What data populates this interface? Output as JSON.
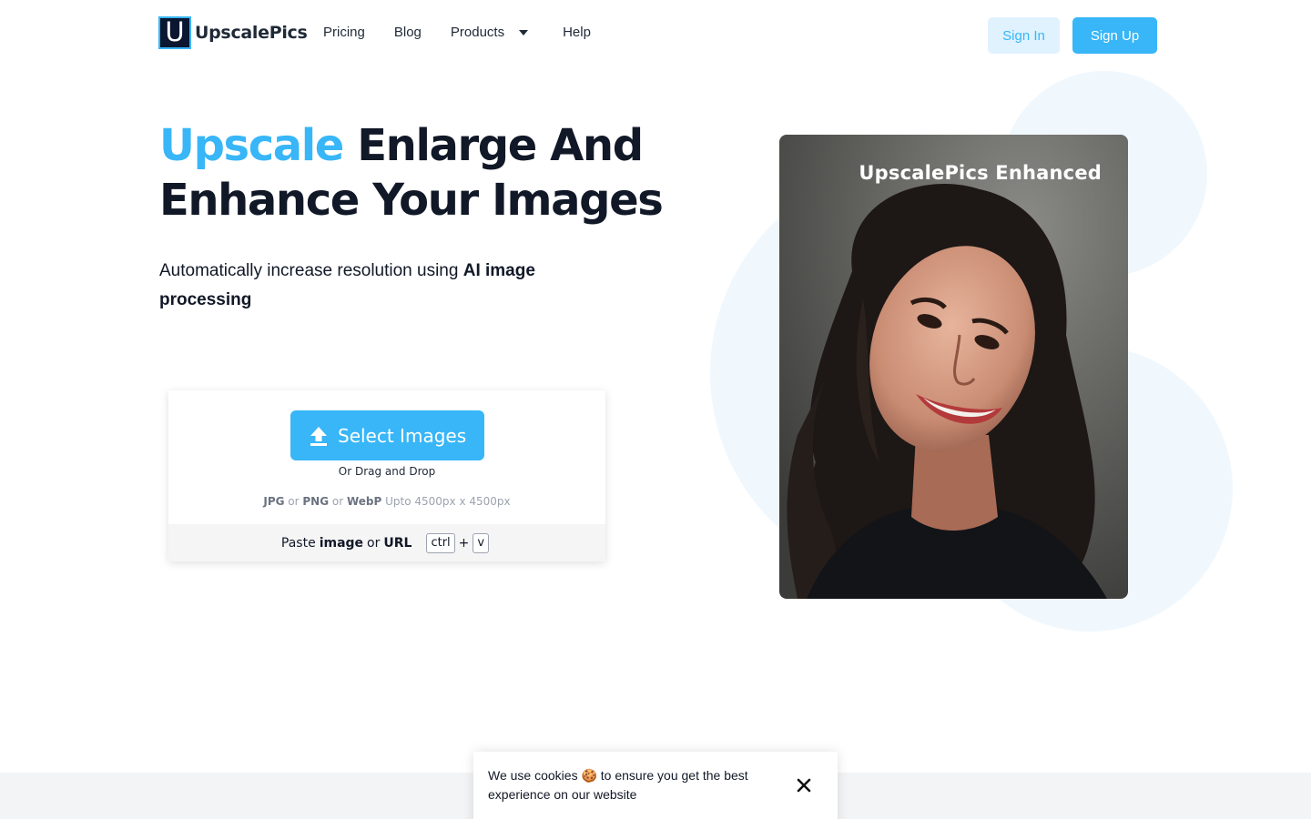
{
  "brand": {
    "logo_letter": "U",
    "name": "UpscalePics"
  },
  "nav": {
    "links": [
      {
        "label": "Pricing"
      },
      {
        "label": "Blog"
      },
      {
        "label": "Products"
      },
      {
        "label": "Help"
      }
    ],
    "sign_in": "Sign In",
    "sign_up": "Sign Up"
  },
  "hero": {
    "title_accent": "Upscale",
    "title_rest": " Enlarge And Enhance Your Images",
    "subtitle_plain": "Automatically increase resolution using ",
    "subtitle_bold": "AI image processing"
  },
  "upload": {
    "select_button": "Select Images",
    "drag_text": "Or Drag and Drop",
    "formats": {
      "f1": "JPG",
      "or1": " or ",
      "f2": "PNG",
      "or2": " or ",
      "f3": "WebP",
      "limit": " Upto 4500px x 4500px"
    },
    "paste": {
      "prefix": "Paste",
      "image": "image",
      "or": "or",
      "url": "URL",
      "key1": "ctrl",
      "plus": "+",
      "key2": "v"
    }
  },
  "preview": {
    "label": "UpscalePics Enhanced",
    "icon": "portrait-photo"
  },
  "cookie": {
    "text": "We use cookies 🍪 to ensure you get the best experience on our website",
    "close_icon": "close-icon"
  },
  "colors": {
    "accent": "#38b6f7",
    "accent_light": "#dff2fd",
    "text": "#111827",
    "blob": "#f0f8fe"
  }
}
